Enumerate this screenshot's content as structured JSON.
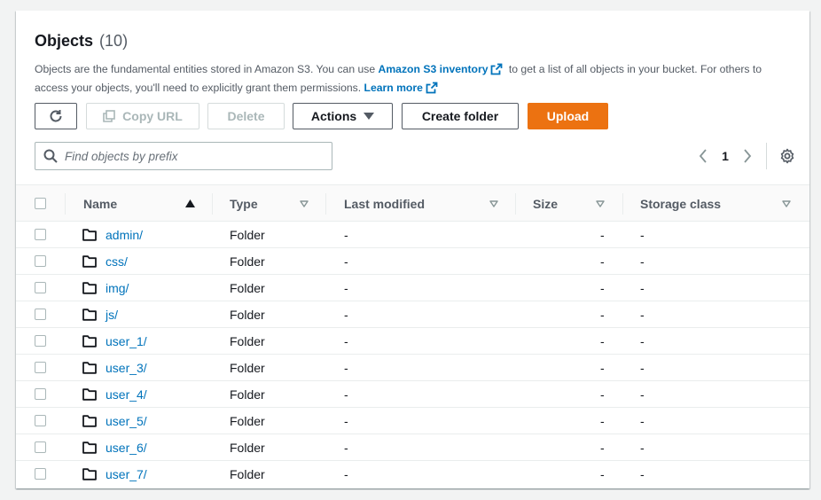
{
  "header": {
    "title": "Objects",
    "count": "(10)"
  },
  "description": {
    "part1": "Objects are the fundamental entities stored in Amazon S3. You can use",
    "link1": "Amazon S3 inventory",
    "part2": "to get a list of all objects in your bucket. For others to access your objects, you'll need to explicitly grant them permissions.",
    "link2": "Learn more"
  },
  "toolbar": {
    "refresh_icon": "refresh-icon",
    "copy_url_label": "Copy URL",
    "delete_label": "Delete",
    "actions_label": "Actions",
    "create_folder_label": "Create folder",
    "upload_label": "Upload"
  },
  "search": {
    "placeholder": "Find objects by prefix",
    "value": ""
  },
  "pagination": {
    "current_page": "1"
  },
  "table": {
    "columns": [
      "Name",
      "Type",
      "Last modified",
      "Size",
      "Storage class"
    ],
    "rows": [
      {
        "name": "admin/",
        "type": "Folder",
        "last_modified": "-",
        "size": "-",
        "storage_class": "-"
      },
      {
        "name": "css/",
        "type": "Folder",
        "last_modified": "-",
        "size": "-",
        "storage_class": "-"
      },
      {
        "name": "img/",
        "type": "Folder",
        "last_modified": "-",
        "size": "-",
        "storage_class": "-"
      },
      {
        "name": "js/",
        "type": "Folder",
        "last_modified": "-",
        "size": "-",
        "storage_class": "-"
      },
      {
        "name": "user_1/",
        "type": "Folder",
        "last_modified": "-",
        "size": "-",
        "storage_class": "-"
      },
      {
        "name": "user_3/",
        "type": "Folder",
        "last_modified": "-",
        "size": "-",
        "storage_class": "-"
      },
      {
        "name": "user_4/",
        "type": "Folder",
        "last_modified": "-",
        "size": "-",
        "storage_class": "-"
      },
      {
        "name": "user_5/",
        "type": "Folder",
        "last_modified": "-",
        "size": "-",
        "storage_class": "-"
      },
      {
        "name": "user_6/",
        "type": "Folder",
        "last_modified": "-",
        "size": "-",
        "storage_class": "-"
      },
      {
        "name": "user_7/",
        "type": "Folder",
        "last_modified": "-",
        "size": "-",
        "storage_class": "-"
      }
    ]
  },
  "colors": {
    "link": "#0073bb",
    "primary_button": "#ec7211",
    "text": "#16191f",
    "secondary_text": "#545b64"
  }
}
